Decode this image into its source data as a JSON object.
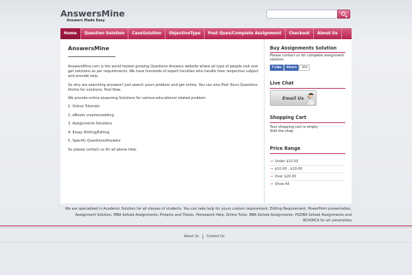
{
  "header": {
    "site_title": "AnswersMine",
    "tagline": "Answers Made Easy",
    "search_placeholder": ""
  },
  "nav": {
    "items": [
      {
        "label": "Home",
        "active": true
      },
      {
        "label": "Question Solution"
      },
      {
        "label": "CaseSolution"
      },
      {
        "label": "ObjectiveType"
      },
      {
        "label": "Post Ques/Complete Assignment"
      },
      {
        "label": "Checkout"
      },
      {
        "label": "About Us"
      }
    ]
  },
  "main": {
    "title": "AnswersMine",
    "para1": "AnswersMine.com is the world fastest growing Questions Answers website where all type of people visit and get solutions as per requirements. We have hundreds of expert faculties who handle their respective subject and provide help.",
    "para2": "So why are searching anywere? just search yours problem and get online. You can also Post Yours Questions Online for solutions. Post Now.",
    "para3": "We provide online eLearning Solutions for various educational related problem.",
    "list": [
      "1. Online Tutorials",
      "2. eBooks creation/editing",
      "3. Assignments Solutions",
      "4. Essay Writing/Editing",
      "5. Specific Questions/Answers"
    ],
    "closing": "So please contact us for all above help."
  },
  "sidebar": {
    "buy_title": "Buy Assignments Solution",
    "buy_text": "Please contact us for complete assignment solution.",
    "fb_like": "Like",
    "fb_share": "Share",
    "fb_count": "364",
    "chat_title": "Live Chat",
    "email_label": "Email Us",
    "cart_title": "Shopping Cart",
    "cart_text": "Your shopping cart is empty",
    "cart_link": "Visit the shop",
    "price_title": "Price Range",
    "price_items": [
      "Under $10.00",
      "$10.00 - $19.00",
      "Over $20.00",
      "Show All"
    ]
  },
  "footer": {
    "text": "We are specialized in Academic Solution for all classes of students. You can take help for yours custom requirement, Editing Requirement, PowerPoint presentation, Assignment Solution, MBA Solved Assignments, Projects and Thesis, Homework Help, Online Tutor, BBA Solved Assignments, PGDBA Solved Assignments and BCA/MCA for all universities",
    "links": [
      "About Us",
      "Contact Us"
    ]
  },
  "colors": {
    "accent": "#b6234e",
    "nav_active": "#8c1536"
  }
}
